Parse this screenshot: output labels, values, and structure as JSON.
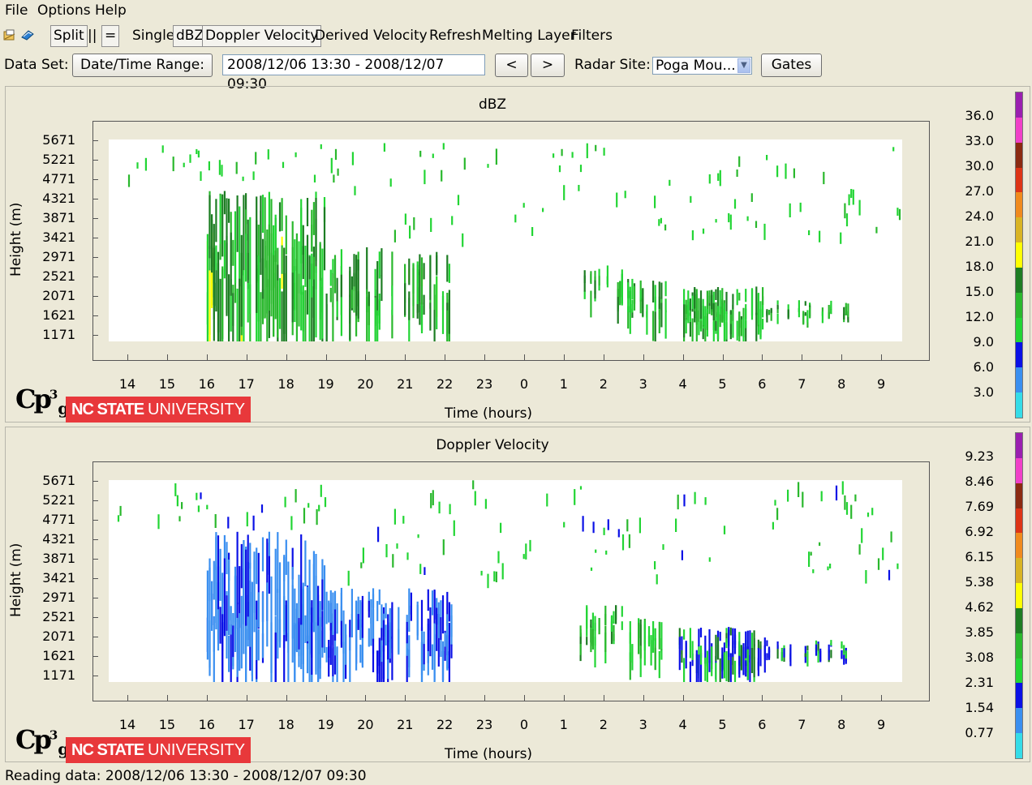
{
  "menu": [
    "File",
    "Options",
    "Help"
  ],
  "toolbar": {
    "split": "Split",
    "parallel": "||",
    "equal": "=",
    "single": "Single",
    "dbz": "dBZ",
    "doppler": "Doppler Velocity",
    "derived": "Derived Velocity",
    "refresh": "Refresh",
    "melting": "Melting Layer",
    "filters": "Filters"
  },
  "dataset": {
    "label": "Data Set:",
    "range_button": "Date/Time Range:",
    "range_value": "2008/12/06 13:30 - 2008/12/07 09:30",
    "prev": "<",
    "next": ">",
    "site_label": "Radar Site:",
    "site_value": "Poga Mou...",
    "gates": "Gates"
  },
  "logo": {
    "cp": "Cp",
    "sup": "3",
    "sub": "g",
    "ncsu_bold": "NC STATE",
    "ncsu_light": "UNIVERSITY"
  },
  "status": "Reading data: 2008/12/06 13:30 - 2008/12/07 09:30",
  "chart_data": [
    {
      "type": "heatmap",
      "title": "dBZ",
      "xlabel": "Time (hours)",
      "ylabel": "Height (m)",
      "x_ticks": [
        "14",
        "15",
        "16",
        "17",
        "18",
        "19",
        "20",
        "21",
        "22",
        "23",
        "0",
        "1",
        "2",
        "3",
        "4",
        "5",
        "6",
        "7",
        "8",
        "9"
      ],
      "y_ticks": [
        "5671",
        "5221",
        "4771",
        "4321",
        "3871",
        "3421",
        "2971",
        "2521",
        "2071",
        "1621",
        "1171"
      ],
      "colorbar": [
        "36.0",
        "33.0",
        "30.0",
        "27.0",
        "24.0",
        "21.0",
        "18.0",
        "15.0",
        "12.0",
        "9.0",
        "6.0",
        "3.0"
      ],
      "colorbar_colors": [
        "#9a1fb0",
        "#f040c8",
        "#8b2a12",
        "#dd3416",
        "#f08a1e",
        "#d9b424",
        "#ffff00",
        "#1d7d23",
        "#2ab82d",
        "#22d534",
        "#0a10e6",
        "#3a8ff0",
        "#35dce8"
      ],
      "clusters": [
        {
          "t": [
            13.7,
            19.5
          ],
          "h": [
            4770,
            5700
          ],
          "density": 0.12,
          "kind": "sparse"
        },
        {
          "t": [
            19.5,
            9.5
          ],
          "h": [
            3500,
            5700
          ],
          "density": 0.16,
          "kind": "sparse"
        },
        {
          "t": [
            16.0,
            19.0
          ],
          "h": [
            1050,
            4500
          ],
          "density": 0.7,
          "kind": "core"
        },
        {
          "t": [
            19.0,
            22.2
          ],
          "h": [
            1100,
            3200
          ],
          "density": 0.45,
          "kind": "core"
        },
        {
          "t": [
            1.4,
            2.5
          ],
          "h": [
            1700,
            2800
          ],
          "density": 0.25,
          "kind": "mid"
        },
        {
          "t": [
            2.6,
            3.6
          ],
          "h": [
            1300,
            2500
          ],
          "density": 0.45,
          "kind": "mid"
        },
        {
          "t": [
            3.9,
            6.1
          ],
          "h": [
            1100,
            2300
          ],
          "density": 0.6,
          "kind": "mid"
        },
        {
          "t": [
            6.1,
            8.2
          ],
          "h": [
            1500,
            2000
          ],
          "density": 0.2,
          "kind": "mid"
        }
      ]
    },
    {
      "type": "heatmap",
      "title": "Doppler Velocity",
      "xlabel": "Time (hours)",
      "ylabel": "Height (m)",
      "x_ticks": [
        "14",
        "15",
        "16",
        "17",
        "18",
        "19",
        "20",
        "21",
        "22",
        "23",
        "0",
        "1",
        "2",
        "3",
        "4",
        "5",
        "6",
        "7",
        "8",
        "9"
      ],
      "y_ticks": [
        "5671",
        "5221",
        "4771",
        "4321",
        "3871",
        "3421",
        "2971",
        "2521",
        "2071",
        "1621",
        "1171"
      ],
      "colorbar": [
        "9.23",
        "8.46",
        "7.69",
        "6.92",
        "6.15",
        "5.38",
        "4.62",
        "3.85",
        "3.08",
        "2.31",
        "1.54",
        "0.77"
      ],
      "colorbar_colors": [
        "#9a1fb0",
        "#f040c8",
        "#8b2a12",
        "#dd3416",
        "#f08a1e",
        "#d9b424",
        "#ffff00",
        "#1d7d23",
        "#2ab82d",
        "#22d534",
        "#0a10e6",
        "#3a8ff0",
        "#35dce8"
      ],
      "clusters": [
        {
          "t": [
            13.7,
            19.5
          ],
          "h": [
            4770,
            5700
          ],
          "density": 0.12,
          "kind": "sparse"
        },
        {
          "t": [
            19.5,
            9.5
          ],
          "h": [
            3500,
            5700
          ],
          "density": 0.16,
          "kind": "sparse"
        },
        {
          "t": [
            16.0,
            19.0
          ],
          "h": [
            1050,
            4500
          ],
          "density": 0.75,
          "kind": "blue"
        },
        {
          "t": [
            19.0,
            22.2
          ],
          "h": [
            1100,
            3200
          ],
          "density": 0.5,
          "kind": "blue"
        },
        {
          "t": [
            1.4,
            2.5
          ],
          "h": [
            1700,
            2800
          ],
          "density": 0.25,
          "kind": "mid"
        },
        {
          "t": [
            2.6,
            3.6
          ],
          "h": [
            1300,
            2500
          ],
          "density": 0.45,
          "kind": "mid"
        },
        {
          "t": [
            3.9,
            6.1
          ],
          "h": [
            1100,
            2300
          ],
          "density": 0.6,
          "kind": "vmix"
        },
        {
          "t": [
            6.1,
            8.2
          ],
          "h": [
            1500,
            2000
          ],
          "density": 0.25,
          "kind": "vmix"
        }
      ]
    }
  ]
}
